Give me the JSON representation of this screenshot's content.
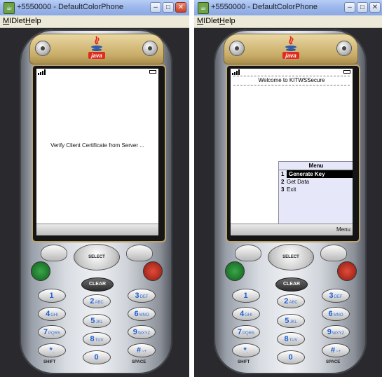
{
  "windows": [
    {
      "title": "+5550000 - DefaultColorPhone",
      "menu": [
        "MIDlet",
        "Help"
      ],
      "screen": {
        "message": "Verify Client Certificate from Server ..."
      }
    },
    {
      "title": "+5550000 - DefaultColorPhone",
      "menu": [
        "MIDlet",
        "Help"
      ],
      "screen": {
        "welcome": "Welcome to KITWSSecure",
        "menu_title": "Menu",
        "menu_items": [
          {
            "num": "1",
            "label": "Generate Key"
          },
          {
            "num": "2",
            "label": "Get Data"
          },
          {
            "num": "3",
            "label": "Exit"
          }
        ],
        "soft_right": "Menu"
      }
    }
  ],
  "phone": {
    "logo": "java",
    "select": "SELECT",
    "clear": "CLEAR",
    "keys": [
      {
        "n": "1",
        "l": "  "
      },
      {
        "n": "2",
        "l": "ABC"
      },
      {
        "n": "3",
        "l": "DEF"
      },
      {
        "n": "4",
        "l": "GHI"
      },
      {
        "n": "5",
        "l": "JKL"
      },
      {
        "n": "6",
        "l": "MNO"
      },
      {
        "n": "7",
        "l": "PQRS"
      },
      {
        "n": "8",
        "l": "TUV"
      },
      {
        "n": "9",
        "l": "WXYZ"
      },
      {
        "n": "*",
        "l": "."
      },
      {
        "n": "0",
        "l": ""
      },
      {
        "n": "#",
        "l": "~+"
      }
    ],
    "shift": "SHIFT",
    "space": "SPACE",
    "icons": [
      "call-icon",
      "hangup-icon"
    ]
  },
  "colors": {
    "titlebar": "#9db8ec",
    "selection": "#000000",
    "menu_bg": "#e6e8f9",
    "key_text": "#1e5fd4"
  }
}
